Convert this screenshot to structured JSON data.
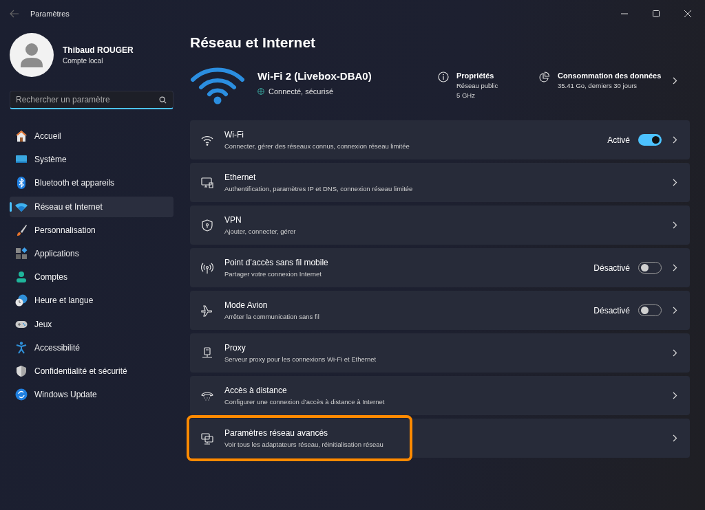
{
  "window": {
    "title": "Paramètres"
  },
  "user": {
    "name": "Thibaud ROUGER",
    "account": "Compte local"
  },
  "search": {
    "placeholder": "Rechercher un paramètre"
  },
  "sidebar": {
    "items": [
      {
        "label": "Accueil",
        "selected": false
      },
      {
        "label": "Système",
        "selected": false
      },
      {
        "label": "Bluetooth et appareils",
        "selected": false
      },
      {
        "label": "Réseau et Internet",
        "selected": true
      },
      {
        "label": "Personnalisation",
        "selected": false
      },
      {
        "label": "Applications",
        "selected": false
      },
      {
        "label": "Comptes",
        "selected": false
      },
      {
        "label": "Heure et langue",
        "selected": false
      },
      {
        "label": "Jeux",
        "selected": false
      },
      {
        "label": "Accessibilité",
        "selected": false
      },
      {
        "label": "Confidentialité et sécurité",
        "selected": false
      },
      {
        "label": "Windows Update",
        "selected": false
      }
    ]
  },
  "page": {
    "title": "Réseau et Internet"
  },
  "connection": {
    "name": "Wi-Fi 2 (Livebox-DBA0)",
    "status": "Connecté, sécurisé",
    "properties": {
      "title": "Propriétés",
      "lines": [
        "Réseau public",
        "5 GHz"
      ]
    },
    "data_usage": {
      "title": "Consommation des données",
      "detail": "35.41 Go, derniers 30 jours"
    }
  },
  "settings": [
    {
      "kind": "toggle",
      "title": "Wi-Fi",
      "subtitle": "Connecter, gérer des réseaux connus, connexion réseau limitée",
      "state_label": "Activé",
      "on": true,
      "highlighted": false
    },
    {
      "kind": "link",
      "title": "Ethernet",
      "subtitle": "Authentification, paramètres IP et DNS, connexion réseau limitée",
      "highlighted": false
    },
    {
      "kind": "link",
      "title": "VPN",
      "subtitle": "Ajouter, connecter, gérer",
      "highlighted": false
    },
    {
      "kind": "toggle",
      "title": "Point d’accès sans fil mobile",
      "subtitle": "Partager votre connexion Internet",
      "state_label": "Désactivé",
      "on": false,
      "highlighted": false
    },
    {
      "kind": "toggle",
      "title": "Mode Avion",
      "subtitle": "Arrêter la communication sans fil",
      "state_label": "Désactivé",
      "on": false,
      "highlighted": false
    },
    {
      "kind": "link",
      "title": "Proxy",
      "subtitle": "Serveur proxy pour les connexions Wi-Fi et Ethernet",
      "highlighted": false
    },
    {
      "kind": "link",
      "title": "Accès à distance",
      "subtitle": "Configurer une connexion d’accès à distance à Internet",
      "highlighted": false
    },
    {
      "kind": "link",
      "title": "Paramètres réseau avancés",
      "subtitle": "Voir tous les adaptateurs réseau, réinitialisation réseau",
      "highlighted": true
    }
  ]
}
